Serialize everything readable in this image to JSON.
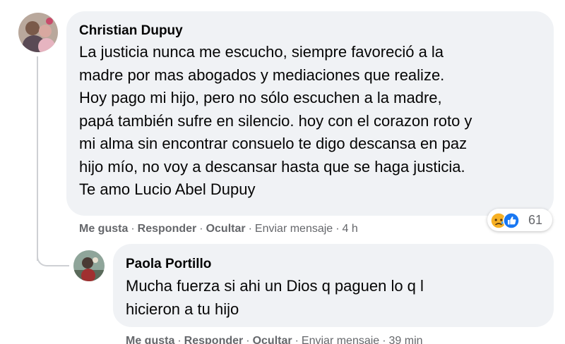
{
  "comments": [
    {
      "author": "Christian Dupuy",
      "text_lines": [
        "La justicia nunca me escucho, siempre favoreció a la",
        "madre por mas abogados y mediaciones que realize.",
        "Hoy pago mi hijo, pero no sólo escuchen a la madre,",
        "papá también sufre en silencio. hoy con el corazon roto y",
        "mi alma sin encontrar consuelo te digo descansa en paz",
        "hijo mío, no voy a descansar hasta que se haga justicia.",
        "Te amo Lucio Abel Dupuy"
      ],
      "actions": {
        "like": "Me gusta",
        "reply": "Responder",
        "hide": "Ocultar",
        "message": "Enviar mensaje",
        "time": "4 h"
      },
      "reactions": {
        "icons": [
          "sad-reaction-icon",
          "like-reaction-icon"
        ],
        "count": "61"
      }
    },
    {
      "author": "Paola Portillo",
      "text_lines": [
        "Mucha fuerza si ahi un Dios q paguen lo q l",
        "hicieron a tu hijo"
      ],
      "actions": {
        "like": "Me gusta",
        "reply": "Responder",
        "hide": "Ocultar",
        "message": "Enviar mensaje",
        "time": "39 min"
      }
    }
  ],
  "colors": {
    "bubble": "#f0f2f5",
    "secondary_text": "#65676b",
    "like_blue": "#1877f2",
    "sad_yellow": "#f7b125",
    "thread_line": "#ced0d4"
  }
}
